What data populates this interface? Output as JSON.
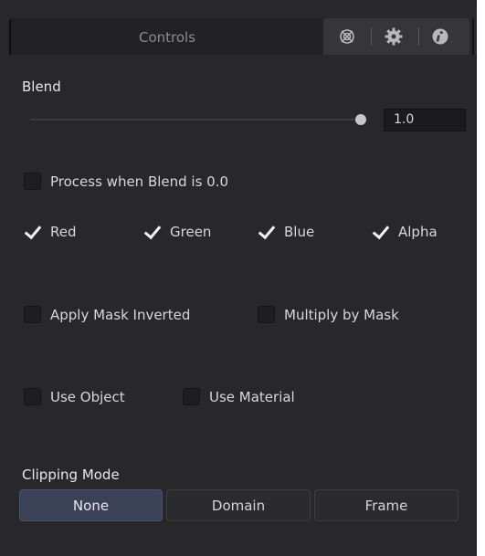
{
  "tabs": {
    "controls_label": "Controls",
    "icons": [
      "target-icon",
      "gear-icon",
      "info-icon"
    ]
  },
  "blend": {
    "label": "Blend",
    "value": "1.0",
    "slider_fraction": 1.0
  },
  "process_when_blend_zero": {
    "label": "Process when Blend is 0.0",
    "checked": false
  },
  "channels": [
    {
      "label": "Red",
      "checked": true
    },
    {
      "label": "Green",
      "checked": true
    },
    {
      "label": "Blue",
      "checked": true
    },
    {
      "label": "Alpha",
      "checked": true
    }
  ],
  "mask": {
    "apply_inverted": {
      "label": "Apply Mask Inverted",
      "checked": false
    },
    "multiply": {
      "label": "Multiply by Mask",
      "checked": false
    }
  },
  "use": {
    "object": {
      "label": "Use Object",
      "checked": false
    },
    "material": {
      "label": "Use Material",
      "checked": false
    }
  },
  "clipping_mode": {
    "label": "Clipping Mode",
    "options": [
      "None",
      "Domain",
      "Frame"
    ],
    "selected": "None"
  },
  "colors": {
    "panel_bg": "#28282b",
    "active_segment": "#3b4157",
    "checkmark": "#f2f2f2"
  }
}
